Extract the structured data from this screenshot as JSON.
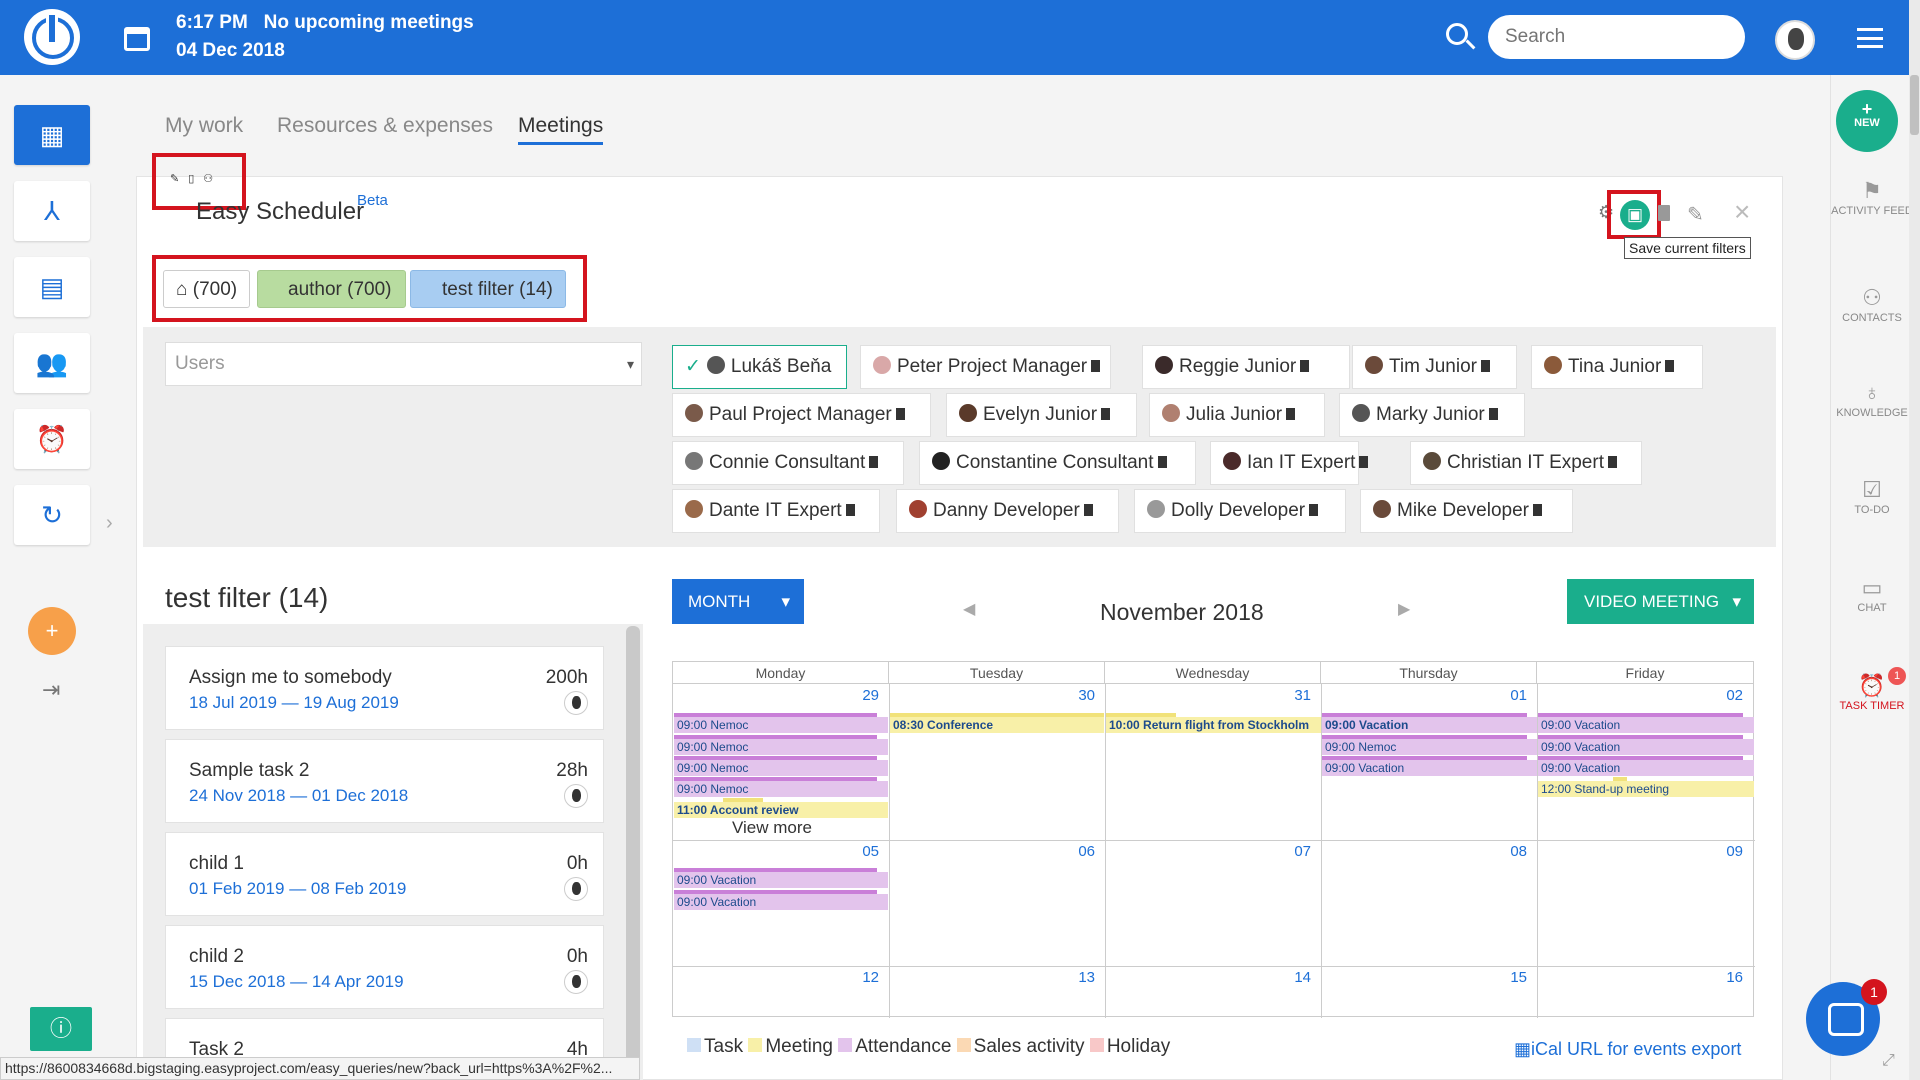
{
  "topbar": {
    "time": "6:17 PM",
    "meetings": "No upcoming meetings",
    "date": "04 Dec 2018",
    "search_placeholder": "Search"
  },
  "tabs": [
    "My work",
    "Resources & expenses",
    "Meetings"
  ],
  "scheduler": {
    "title": "Easy Scheduler",
    "beta": "Beta",
    "tooltip": "Save current filters"
  },
  "filters": [
    {
      "label": "(700)"
    },
    {
      "label": "author (700)"
    },
    {
      "label": "test filter (14)"
    }
  ],
  "users_select": "Users",
  "users": [
    "Lukáš Beňa",
    "Peter Project Manager",
    "Reggie Junior",
    "Tim Junior",
    "Tina Junior",
    "Paul Project Manager",
    "Evelyn Junior",
    "Julia Junior",
    "Marky Junior",
    "Connie Consultant",
    "Constantine Consultant",
    "Ian IT Expert",
    "Christian IT Expert",
    "Dante IT Expert",
    "Danny Developer",
    "Dolly Developer",
    "Mike Developer"
  ],
  "task_list": {
    "title": "test filter (14)",
    "tasks": [
      {
        "name": "Assign me to somebody",
        "start": "18 Jul 2019",
        "sep": "—",
        "end": "19 Aug 2019",
        "hours": "200h"
      },
      {
        "name": "Sample task 2",
        "start": "24 Nov 2018",
        "sep": "—",
        "end": "01 Dec 2018",
        "hours": "28h"
      },
      {
        "name": "child 1",
        "start": "01 Feb 2019",
        "sep": "—",
        "end": "08 Feb 2019",
        "hours": "0h"
      },
      {
        "name": "child 2",
        "start": "15 Dec 2018",
        "sep": "—",
        "end": "14 Apr 2019",
        "hours": "0h"
      },
      {
        "name": "Task 2",
        "start": "",
        "sep": "",
        "end": "",
        "hours": "4h"
      }
    ]
  },
  "calendar": {
    "view_button": "MONTH",
    "title": "November 2018",
    "video_button": "VIDEO MEETING",
    "days": [
      "Monday",
      "Tuesday",
      "Wednesday",
      "Thursday",
      "Friday"
    ],
    "week_numbers": [
      [
        "29",
        "30",
        "31",
        "01",
        "02"
      ],
      [
        "05",
        "06",
        "07",
        "08",
        "09"
      ],
      [
        "12",
        "13",
        "14",
        "15",
        "16"
      ]
    ],
    "events": {
      "mon_1": "09:00 Nemoc",
      "mon_2": "09:00 Nemoc",
      "mon_3": "09:00 Nemoc",
      "mon_4": "09:00 Nemoc",
      "mon_5": "11:00 Account review",
      "tue_1": "08:30 Conference",
      "wed_1": "10:00 Return flight from Stockholm",
      "thu_1": "09:00 Vacation",
      "thu_2": "09:00 Nemoc",
      "thu_3": "09:00 Vacation",
      "fri_1": "09:00 Vacation",
      "fri_2": "09:00 Vacation",
      "fri_3": "09:00 Vacation",
      "fri_4": "12:00 Stand-up meeting",
      "w2_mon_1": "09:00 Vacation",
      "w2_mon_2": "09:00 Vacation"
    },
    "view_more": "View more",
    "legend": [
      "Task",
      "Meeting",
      "Attendance",
      "Sales activity",
      "Holiday"
    ],
    "legend_colors": [
      "#cfe0f5",
      "#f8f0a8",
      "#e3c4ec",
      "#fbd9b4",
      "#f8c8c8"
    ],
    "ical": "iCal URL for events export"
  },
  "right_sidebar": {
    "new": "NEW",
    "items": [
      "ACTIVITY FEED",
      "CONTACTS",
      "KNOWLEDGE",
      "TO-DO",
      "CHAT",
      "TASK TIMER"
    ],
    "timer_badge": "1"
  },
  "chat_badge": "1",
  "status_url": "https://8600834668d.bigstaging.easyproject.com/easy_queries/new?back_url=https%3A%2F%2..."
}
